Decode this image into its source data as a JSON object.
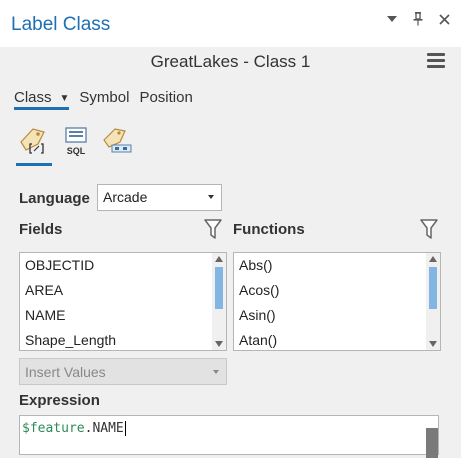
{
  "panel": {
    "title": "Label Class"
  },
  "layer": {
    "name": "GreatLakes - Class 1"
  },
  "tabs": [
    {
      "label": "Class",
      "active": true,
      "has_dropdown": true
    },
    {
      "label": "Symbol",
      "active": false
    },
    {
      "label": "Position",
      "active": false
    }
  ],
  "modes": [
    {
      "name": "label-expression-icon",
      "active": true
    },
    {
      "name": "sql-query-icon",
      "active": false,
      "text": "SQL"
    },
    {
      "name": "label-placement-icon",
      "active": false
    }
  ],
  "language": {
    "label": "Language",
    "value": "Arcade"
  },
  "fields": {
    "label": "Fields",
    "items": [
      "OBJECTID",
      "AREA",
      "NAME",
      "Shape_Length"
    ]
  },
  "functions": {
    "label": "Functions",
    "items": [
      "Abs()",
      "Acos()",
      "Asin()",
      "Atan()"
    ]
  },
  "insert_values": {
    "label": "Insert Values"
  },
  "expression": {
    "label": "Expression",
    "prefix": "$feature",
    "suffix": ".NAME"
  },
  "colors": {
    "accent": "#1f6fb5",
    "scroll_thumb": "#81b6e3",
    "keyword": "#2e8b57"
  }
}
